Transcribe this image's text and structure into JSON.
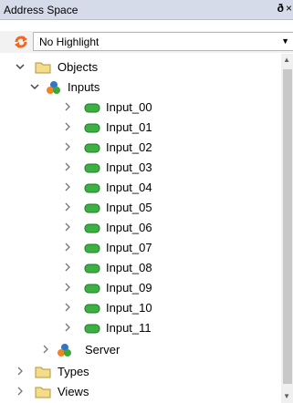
{
  "panel": {
    "title": "Address Space",
    "pin_glyph": "ð",
    "close_glyph": "×"
  },
  "highlight": {
    "value": "No Highlight",
    "refresh_icon": "refresh-icon",
    "dropdown_icon": "chevron-down-icon"
  },
  "tree": {
    "objects": "Objects",
    "inputs": "Inputs",
    "input_items": [
      "Input_00",
      "Input_01",
      "Input_02",
      "Input_03",
      "Input_04",
      "Input_05",
      "Input_06",
      "Input_07",
      "Input_08",
      "Input_09",
      "Input_10",
      "Input_11"
    ],
    "server": "Server",
    "types": "Types",
    "views": "Views"
  },
  "colors": {
    "titlebar": "#d6dbe9",
    "folder": "#e6c86a",
    "variable": "#3cb043",
    "accent_orange": "#f26522"
  }
}
